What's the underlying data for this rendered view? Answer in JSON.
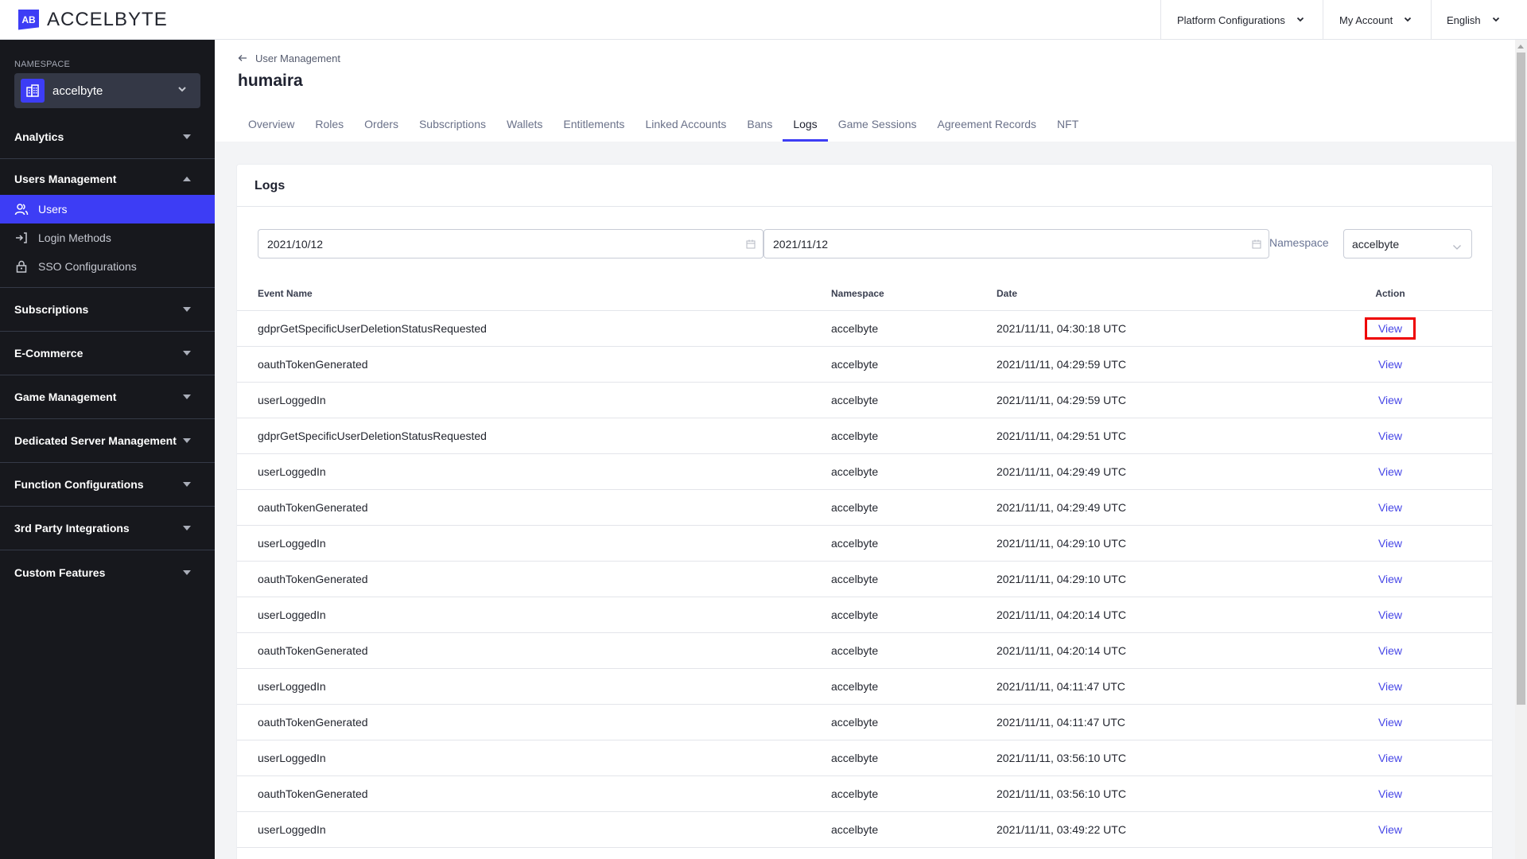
{
  "topbar": {
    "logo_mark": "AB",
    "logo_text": "ACCELBYTE",
    "menu": [
      {
        "label": "Platform Configurations"
      },
      {
        "label": "My Account"
      },
      {
        "label": "English"
      }
    ]
  },
  "sidebar": {
    "namespace_label": "NAMESPACE",
    "namespace_value": "accelbyte",
    "groups": [
      {
        "label": "Analytics",
        "expanded": false
      },
      {
        "label": "Users Management",
        "expanded": true,
        "items": [
          {
            "label": "Users",
            "icon": "users-icon",
            "active": true
          },
          {
            "label": "Login Methods",
            "icon": "login-icon",
            "active": false
          },
          {
            "label": "SSO Configurations",
            "icon": "lock-icon",
            "active": false
          }
        ]
      },
      {
        "label": "Subscriptions",
        "expanded": false
      },
      {
        "label": "E-Commerce",
        "expanded": false
      },
      {
        "label": "Game Management",
        "expanded": false
      },
      {
        "label": "Dedicated Server Management",
        "expanded": false
      },
      {
        "label": "Function Configurations",
        "expanded": false
      },
      {
        "label": "3rd Party Integrations",
        "expanded": false
      },
      {
        "label": "Custom Features",
        "expanded": false
      }
    ]
  },
  "header": {
    "breadcrumb": "User Management",
    "title": "humaira",
    "tabs": [
      {
        "label": "Overview"
      },
      {
        "label": "Roles"
      },
      {
        "label": "Orders"
      },
      {
        "label": "Subscriptions"
      },
      {
        "label": "Wallets"
      },
      {
        "label": "Entitlements"
      },
      {
        "label": "Linked Accounts"
      },
      {
        "label": "Bans"
      },
      {
        "label": "Logs",
        "active": true
      },
      {
        "label": "Game Sessions"
      },
      {
        "label": "Agreement Records"
      },
      {
        "label": "NFT"
      }
    ]
  },
  "logs": {
    "title": "Logs",
    "filters": {
      "date_from": "2021/10/12",
      "date_to": "2021/11/12",
      "namespace_label": "Namespace",
      "namespace_value": "accelbyte"
    },
    "columns": {
      "event": "Event Name",
      "namespace": "Namespace",
      "date": "Date",
      "action": "Action"
    },
    "rows": [
      {
        "event": "gdprGetSpecificUserDeletionStatusRequested",
        "namespace": "accelbyte",
        "date": "2021/11/11, 04:30:18 UTC",
        "action": "View"
      },
      {
        "event": "oauthTokenGenerated",
        "namespace": "accelbyte",
        "date": "2021/11/11, 04:29:59 UTC",
        "action": "View"
      },
      {
        "event": "userLoggedIn",
        "namespace": "accelbyte",
        "date": "2021/11/11, 04:29:59 UTC",
        "action": "View"
      },
      {
        "event": "gdprGetSpecificUserDeletionStatusRequested",
        "namespace": "accelbyte",
        "date": "2021/11/11, 04:29:51 UTC",
        "action": "View"
      },
      {
        "event": "userLoggedIn",
        "namespace": "accelbyte",
        "date": "2021/11/11, 04:29:49 UTC",
        "action": "View"
      },
      {
        "event": "oauthTokenGenerated",
        "namespace": "accelbyte",
        "date": "2021/11/11, 04:29:49 UTC",
        "action": "View"
      },
      {
        "event": "userLoggedIn",
        "namespace": "accelbyte",
        "date": "2021/11/11, 04:29:10 UTC",
        "action": "View"
      },
      {
        "event": "oauthTokenGenerated",
        "namespace": "accelbyte",
        "date": "2021/11/11, 04:29:10 UTC",
        "action": "View"
      },
      {
        "event": "userLoggedIn",
        "namespace": "accelbyte",
        "date": "2021/11/11, 04:20:14 UTC",
        "action": "View"
      },
      {
        "event": "oauthTokenGenerated",
        "namespace": "accelbyte",
        "date": "2021/11/11, 04:20:14 UTC",
        "action": "View"
      },
      {
        "event": "userLoggedIn",
        "namespace": "accelbyte",
        "date": "2021/11/11, 04:11:47 UTC",
        "action": "View"
      },
      {
        "event": "oauthTokenGenerated",
        "namespace": "accelbyte",
        "date": "2021/11/11, 04:11:47 UTC",
        "action": "View"
      },
      {
        "event": "userLoggedIn",
        "namespace": "accelbyte",
        "date": "2021/11/11, 03:56:10 UTC",
        "action": "View"
      },
      {
        "event": "oauthTokenGenerated",
        "namespace": "accelbyte",
        "date": "2021/11/11, 03:56:10 UTC",
        "action": "View"
      },
      {
        "event": "userLoggedIn",
        "namespace": "accelbyte",
        "date": "2021/11/11, 03:49:22 UTC",
        "action": "View"
      }
    ]
  },
  "colors": {
    "accent": "#3d3df5",
    "sidebar_bg": "#17181d",
    "link": "#4646e6",
    "highlight": "#ee0000"
  }
}
